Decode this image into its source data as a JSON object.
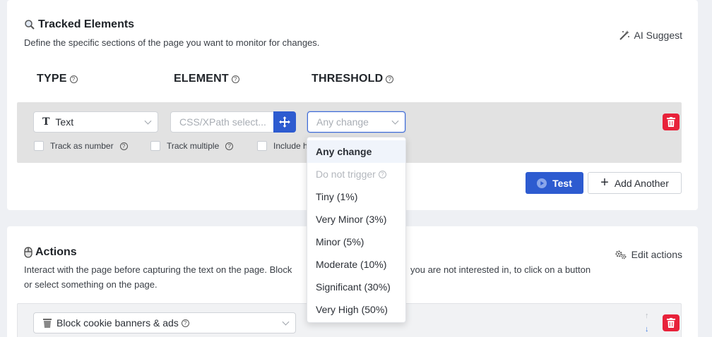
{
  "tracked": {
    "title": "Tracked Elements",
    "description": "Define the specific sections of the page you want to monitor for changes.",
    "ai_suggest": "AI Suggest",
    "columns": {
      "type": "TYPE",
      "element": "ELEMENT",
      "threshold": "THRESHOLD"
    },
    "row": {
      "type_value": "Text",
      "element_placeholder": "CSS/XPath select...",
      "threshold_placeholder": "Any change",
      "checkboxes": [
        "Track as number",
        "Track multiple",
        "Include h"
      ]
    },
    "test_label": "Test",
    "add_label": "Add Another",
    "dropdown_options": [
      "Any change",
      "Do not trigger",
      "Tiny (1%)",
      "Very Minor (3%)",
      "Minor (5%)",
      "Moderate (10%)",
      "Significant (30%)",
      "Very High (50%)"
    ]
  },
  "actions": {
    "title": "Actions",
    "edit_label": "Edit actions",
    "description_line1": "Interact with the page before capturing the text on the page. Block",
    "description_line1_tail": "you are not interested in, to click on a button",
    "description_line2": "or select something on the page.",
    "row_value": "Block cookie banners & ads"
  },
  "colors": {
    "primary": "#2d5bd0",
    "danger": "#e8223a",
    "row_bg": "#e2e2e2"
  }
}
